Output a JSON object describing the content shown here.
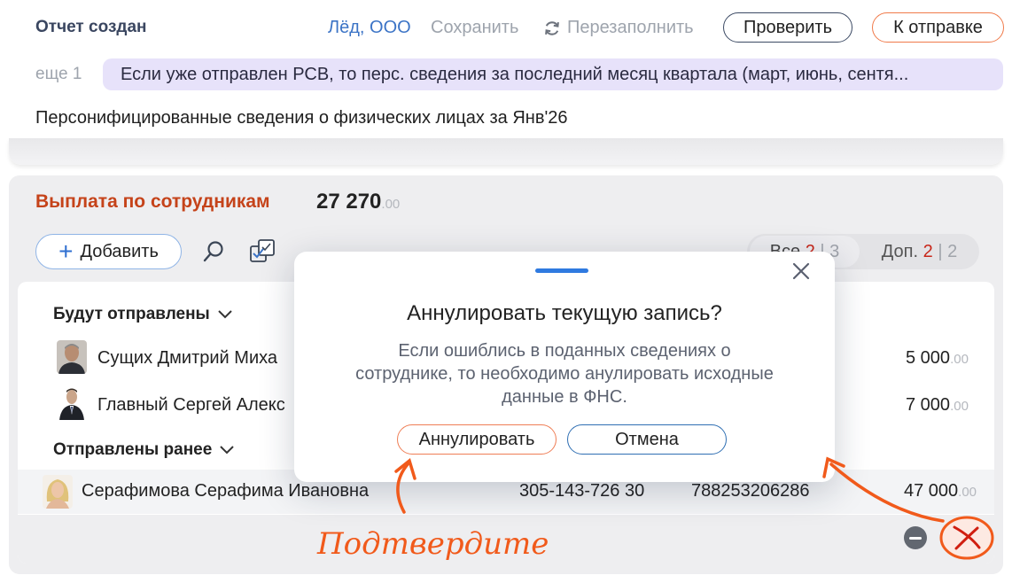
{
  "header": {
    "title": "Отчет создан",
    "org": "Лёд, ООО",
    "save": "Сохранить",
    "refill": "Перезаполнить",
    "check": "Проверить",
    "send": "К отправке",
    "more": "еще 1",
    "notice": "Если уже отправлен РСВ, то перс. сведения за последний месяц квартала (март, июнь, сентя...",
    "subtitle": "Персонифицированные сведения о физических лицах за Янв'26"
  },
  "section": {
    "title": "Выплата по сотрудникам",
    "sum": "27 270",
    "sum_cents": ".00",
    "add": "Добавить",
    "filter_all_label": "Все",
    "filter_all_red": "2",
    "filter_all_sep": "|",
    "filter_all_total": "3",
    "filter_extra_label": "Доп.",
    "filter_extra_red": "2",
    "filter_extra_sep": "|",
    "filter_extra_total": "2"
  },
  "groups": {
    "will_send": "Будут отправлены",
    "sent_before": "Отправлены ранее"
  },
  "rows": [
    {
      "name": "Сущих Дмитрий Миха",
      "amount": "5 000",
      "cents": ".00"
    },
    {
      "name": "Главный Сергей Алекс",
      "amount": "7 000",
      "cents": ".00"
    },
    {
      "name": "Серафимова Серафима Ивановна",
      "snils": "305-143-726 30",
      "inn": "788253206286",
      "amount": "47 000",
      "cents": ".00"
    }
  ],
  "modal": {
    "title": "Аннулировать текущую запись?",
    "text": "Если ошиблись в поданных сведениях о сотруднике, то необходимо анулировать исходные данные в ФНС.",
    "confirm": "Аннулировать",
    "cancel": "Отмена"
  },
  "annotation": {
    "text": "Подтвердите",
    "color": "#f15a1b"
  },
  "icons": [
    "refresh-icon",
    "plus-icon",
    "search-icon",
    "checklist-icon",
    "chevron-down-icon",
    "close-icon",
    "minus-icon",
    "x-icon"
  ]
}
